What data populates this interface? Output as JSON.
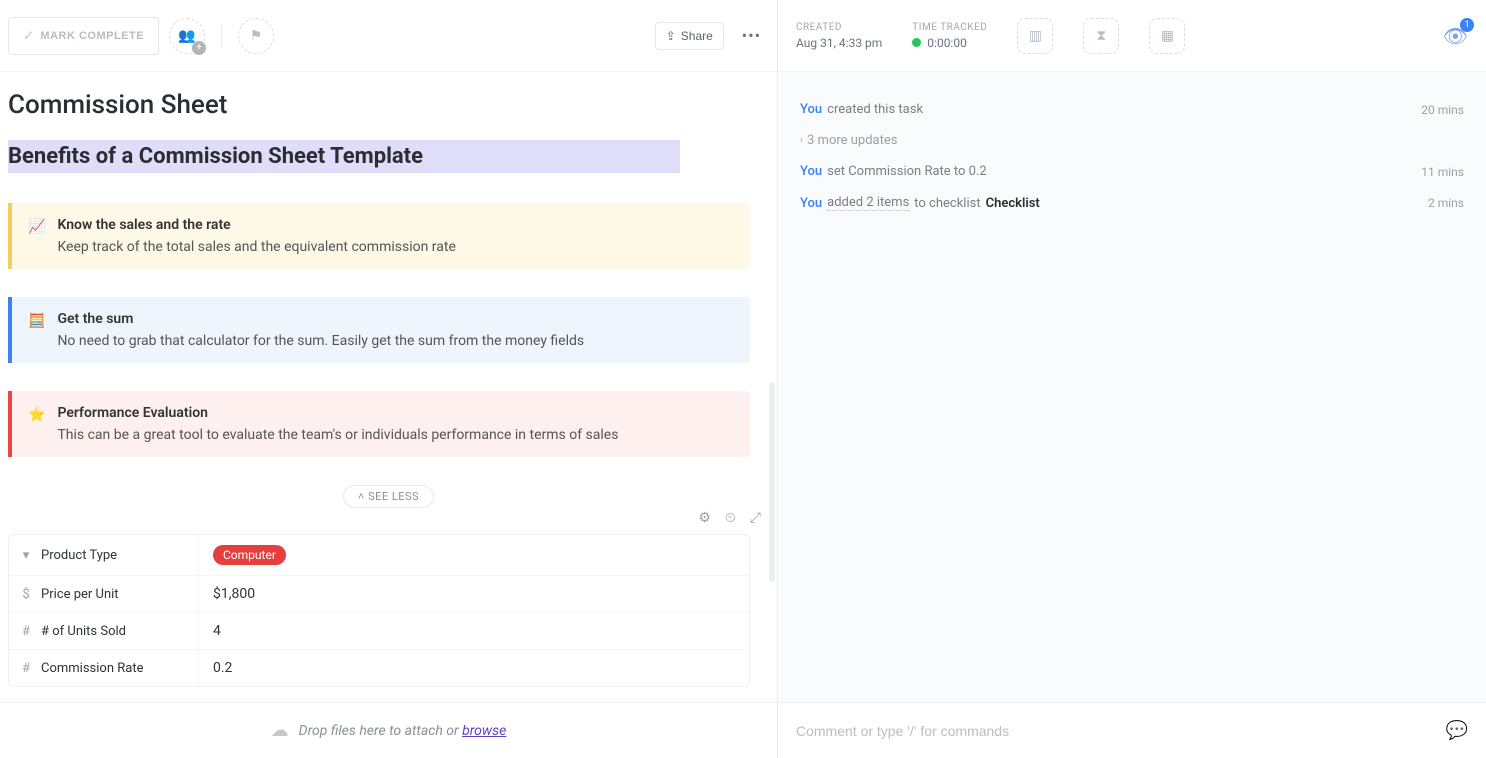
{
  "toolbar": {
    "mark_complete": "MARK COMPLETE",
    "share": "Share"
  },
  "task": {
    "title": "Commission Sheet",
    "heading": "Benefits of a Commission Sheet Template",
    "callouts": [
      {
        "emoji": "📈",
        "title": "Know the sales and the rate",
        "desc": "Keep track of the total sales and the equivalent commission rate"
      },
      {
        "emoji": "🧮",
        "title": "Get the sum",
        "desc": "No need to grab that calculator for the sum. Easily get the sum from the money fields"
      },
      {
        "emoji": "⭐",
        "title": "Performance Evaluation",
        "desc": "This can be a great tool to evaluate the team's or individuals performance in terms of sales"
      }
    ],
    "see_less": "SEE LESS"
  },
  "fields": [
    {
      "icon": "▾",
      "label": "Product Type",
      "value": "Computer",
      "style": "tag"
    },
    {
      "icon": "$",
      "label": "Price per Unit",
      "value": "$1,800",
      "style": "text"
    },
    {
      "icon": "#",
      "label": "# of Units Sold",
      "value": "4",
      "style": "text"
    },
    {
      "icon": "#",
      "label": "Commission Rate",
      "value": "0.2",
      "style": "text"
    }
  ],
  "dropzone": {
    "text": "Drop files here to attach or ",
    "link": "browse"
  },
  "meta": {
    "created_label": "CREATED",
    "created_value": "Aug 31, 4:33 pm",
    "tracked_label": "TIME TRACKED",
    "tracked_value": "0:00:00",
    "watch_count": "1"
  },
  "activity": {
    "items": [
      {
        "type": "simple",
        "you": "You",
        "text": " created this task",
        "time": "20 mins"
      },
      {
        "type": "more",
        "text": "3 more updates"
      },
      {
        "type": "simple",
        "you": "You",
        "text": " set Commission Rate to 0.2",
        "time": "11 mins"
      },
      {
        "type": "checklist",
        "you": "You",
        "added": "added 2 items",
        "to": " to checklist ",
        "target": "Checklist",
        "time": "2 mins"
      }
    ]
  },
  "comment": {
    "placeholder": "Comment or type '/' for commands"
  }
}
